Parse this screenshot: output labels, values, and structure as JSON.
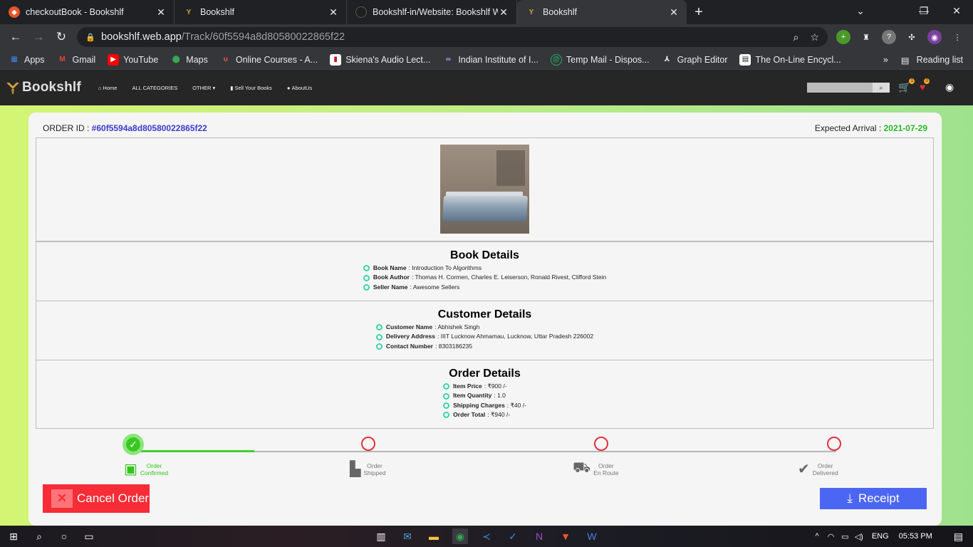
{
  "browser": {
    "tabs": [
      {
        "title": "checkoutBook - Bookshlf",
        "favicon_color": "#e8542a",
        "active": false
      },
      {
        "title": "Bookshlf",
        "favicon_color": "#d4a23a",
        "active": false
      },
      {
        "title": "Bookshlf-in/Website: Bookshlf W",
        "favicon_color": "#1f1f1f",
        "active": false
      },
      {
        "title": "Bookshlf",
        "favicon_color": "#d4a23a",
        "active": true
      }
    ],
    "url_host": "bookshlf.web.app",
    "url_path": "/Track/60f5594a8d80580022865f22",
    "bookmarks": [
      {
        "label": "Apps",
        "icon": "apps-grid-icon",
        "color": "#4285f4"
      },
      {
        "label": "Gmail",
        "icon": "gmail-icon",
        "color": "#ea4335"
      },
      {
        "label": "YouTube",
        "icon": "youtube-icon",
        "color": "#ff0000"
      },
      {
        "label": "Maps",
        "icon": "maps-pin-icon",
        "color": "#34a853"
      },
      {
        "label": "Online Courses - A...",
        "icon": "udemy-icon",
        "color": "#ec5252"
      },
      {
        "label": "Skiena's Audio Lect...",
        "icon": "skiena-icon",
        "color": "#c41230"
      },
      {
        "label": "Indian Institute of I...",
        "icon": "link-icon",
        "color": "#8ab4f8"
      },
      {
        "label": "Temp Mail - Dispos...",
        "icon": "tempmail-icon",
        "color": "#27ae60"
      },
      {
        "label": "Graph Editor",
        "icon": "graph-icon",
        "color": "#e8eaed"
      },
      {
        "label": "The On-Line Encycl...",
        "icon": "oeis-icon",
        "color": "#e8eaed"
      }
    ],
    "reading_list": "Reading list"
  },
  "site": {
    "brand": "Bookshlf",
    "nav": [
      "Home",
      "ALL CATEGORIES",
      "OTHER",
      "Sell Your Books",
      "AboutUs"
    ],
    "cart_count": "1",
    "wish_count": "0"
  },
  "order": {
    "id_label": "ORDER ID : ",
    "id_value": "#60f5594a8d80580022865f22",
    "arrival_label": "Expected Arrival : ",
    "arrival_value": "2021-07-29",
    "book": {
      "heading": "Book Details",
      "items": [
        {
          "label": "Book Name",
          "value": ": Introduction To Algorithms"
        },
        {
          "label": "Book Author",
          "value": ": Thomas H. Cormen, Charles E. Leiserson, Ronald Rivest, Clifford Stein"
        },
        {
          "label": "Seller Name",
          "value": ": Awesome Sellers"
        }
      ]
    },
    "customer": {
      "heading": "Customer Details",
      "items": [
        {
          "label": "Customer Name",
          "value": ": Abhishek Singh"
        },
        {
          "label": "Delivery Address",
          "value": ": IIIT Lucknow Ahmamau, Lucknow, Uttar Pradesh 226002"
        },
        {
          "label": "Contact Number",
          "value": ": 8303186235"
        }
      ]
    },
    "details": {
      "heading": "Order Details",
      "items": [
        {
          "label": "Item Price",
          "value": ": ₹900 /-"
        },
        {
          "label": "Item Quantity",
          "value": ": 1.0"
        },
        {
          "label": "Shipping Charges",
          "value": ": ₹40 /-"
        },
        {
          "label": "Order Total",
          "value": ": ₹940 /-"
        }
      ]
    },
    "steps": [
      {
        "line1": "Order",
        "line2": "Confirmed",
        "done": true,
        "icon": "clipboard-check-icon"
      },
      {
        "line1": "Order",
        "line2": "Shipped",
        "done": false,
        "icon": "dolly-icon"
      },
      {
        "line1": "Order",
        "line2": "En Route",
        "done": false,
        "icon": "truck-icon"
      },
      {
        "line1": "Order",
        "line2": "Delivered",
        "done": false,
        "icon": "double-check-icon"
      }
    ],
    "progress_fraction": 0.17,
    "cancel_label": "Cancel Order",
    "receipt_label": "Receipt"
  },
  "taskbar": {
    "lang": "ENG",
    "time": "05:53 PM"
  }
}
